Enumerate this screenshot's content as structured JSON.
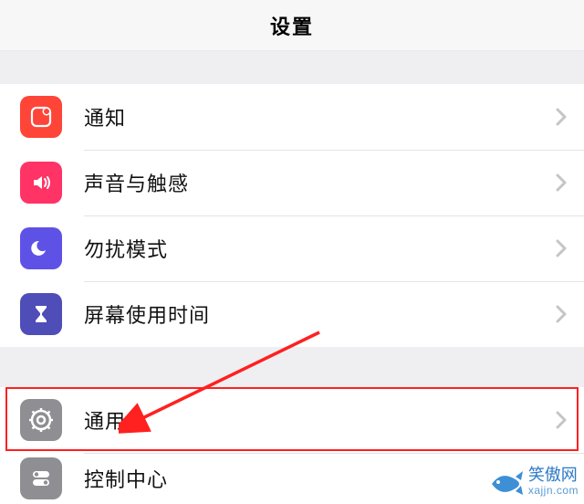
{
  "header": {
    "title": "设置"
  },
  "group1": {
    "notifications": {
      "label": "通知",
      "icon": "notifications-icon",
      "color": "#ff4438"
    },
    "sounds": {
      "label": "声音与触感",
      "icon": "sound-icon",
      "color": "#ff3366"
    },
    "dnd": {
      "label": "勿扰模式",
      "icon": "moon-icon",
      "color": "#5e52e6"
    },
    "screentime": {
      "label": "屏幕使用时间",
      "icon": "hourglass-icon",
      "color": "#4f4db8"
    }
  },
  "group2": {
    "general": {
      "label": "通用",
      "icon": "gear-icon",
      "color": "#8e8e93"
    },
    "controlcenter": {
      "label": "控制中心",
      "icon": "toggles-icon",
      "color": "#8e8e93"
    }
  },
  "annotation": {
    "highlight_target": "general",
    "highlight_color": "#ff2020"
  },
  "watermark": {
    "name": "笑傲网",
    "url": "xajjn.com"
  }
}
